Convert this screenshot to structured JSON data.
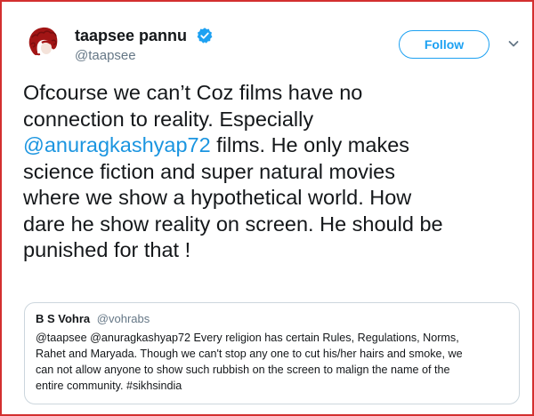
{
  "tweet": {
    "author": {
      "display_name": "taapsee pannu",
      "handle": "@taapsee",
      "verified": true,
      "avatar_icon": "curly-hair-avatar-icon"
    },
    "follow_label": "Follow",
    "menu_icon": "chevron-down-icon",
    "text_lines": [
      "Ofcourse we can’t Coz films have no",
      "connection to reality. Especially",
      "films. He only makes",
      "science fiction and super natural movies",
      "where we show a hypothetical world. How",
      "dare he show reality on screen. He should be",
      "punished for that !"
    ],
    "mention": "@anuragkashyap72",
    "colors": {
      "accent": "#1da1f2",
      "mention": "#1b95e0",
      "frame_border": "#d32f2f",
      "verified": "#1da1f2"
    }
  },
  "quoted_tweet": {
    "author_name": "B S Vohra",
    "author_handle": "@vohrabs",
    "text_lines": [
      "@taapsee @anuragkashyap72 Every religion has certain Rules, Regulations, Norms,",
      "Rahet and Maryada. Though we can't stop any one to cut his/her hairs and smoke, we",
      "can not allow anyone to show such rubbish on the screen to malign the name of the",
      "entire community. #sikhsindia"
    ]
  }
}
